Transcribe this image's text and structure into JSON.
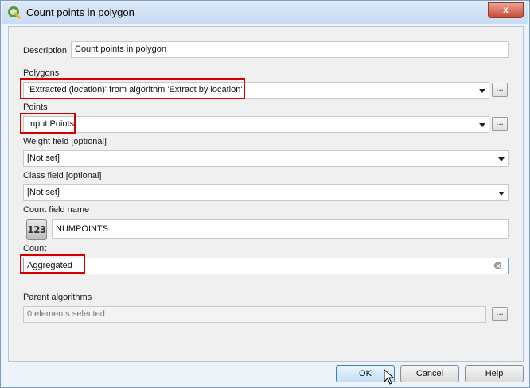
{
  "window": {
    "title": "Count points in polygon"
  },
  "form": {
    "description_label": "Description",
    "description_value": "Count points in polygon",
    "polygons_label": "Polygons",
    "polygons_value": "'Extracted (location)' from algorithm 'Extract by location'",
    "points_label": "Points",
    "points_value": "Input Points",
    "weight_label": "Weight field [optional]",
    "weight_value": "[Not set]",
    "class_label": "Class field [optional]",
    "class_value": "[Not set]",
    "count_field_label": "Count field name",
    "count_field_icon": "123",
    "count_field_value": "NUMPOINTS",
    "count_label": "Count",
    "count_value": "Aggregated",
    "parent_label": "Parent algorithms",
    "parent_value": "0 elements selected",
    "ellipsis": "..."
  },
  "buttons": {
    "ok": "OK",
    "cancel": "Cancel",
    "help": "Help",
    "close": "x"
  },
  "colors": {
    "highlight": "#d40000",
    "title_bar": "#c9dcf2"
  }
}
